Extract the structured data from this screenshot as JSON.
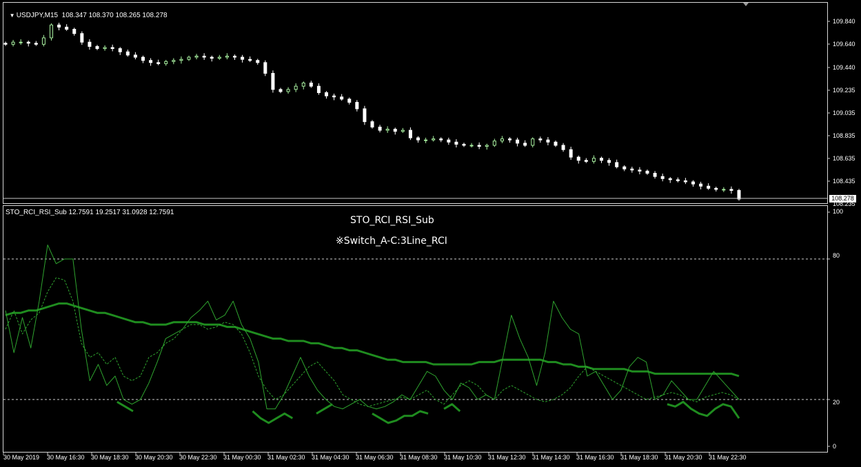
{
  "main_title": "USDJPY,M15  108.347 108.370 108.265 108.278",
  "price_axis": [
    "109.840",
    "109.640",
    "109.440",
    "109.235",
    "109.035",
    "108.835",
    "108.635",
    "108.435",
    "108.235"
  ],
  "current_price": "108.278",
  "indicator_title": "STO_RCI_RSI_Sub 12.7591 19.2517 31.0928 12.7591",
  "indicator_name": "STO_RCI_RSI_Sub",
  "indicator_mode": "※Switch_A-C:3Line_RCI",
  "ind_axis": [
    "100",
    "80",
    "20",
    "0"
  ],
  "time_axis": [
    "30 May 2019",
    "30 May 16:30",
    "30 May 18:30",
    "30 May 20:30",
    "30 May 22:30",
    "31 May 00:30",
    "31 May 02:30",
    "31 May 04:30",
    "31 May 06:30",
    "31 May 08:30",
    "31 May 10:30",
    "31 May 12:30",
    "31 May 14:30",
    "31 May 16:30",
    "31 May 18:30",
    "31 May 20:30",
    "31 May 22:30"
  ],
  "colors": {
    "bull": "#a8f0a0",
    "bear": "#ffffff",
    "line": "#1f8c1f",
    "thin": "#2fa52f"
  },
  "chart_data": [
    {
      "type": "candlestick",
      "symbol": "USDJPY",
      "timeframe": "M15",
      "ylim": [
        108.235,
        109.94
      ],
      "close_path": [
        109.72,
        109.74,
        109.74,
        109.73,
        109.72,
        109.78,
        109.9,
        109.88,
        109.86,
        109.82,
        109.74,
        109.7,
        109.68,
        109.69,
        109.68,
        109.65,
        109.62,
        109.6,
        109.57,
        109.55,
        109.54,
        109.56,
        109.57,
        109.58,
        109.6,
        109.61,
        109.6,
        109.59,
        109.6,
        109.61,
        109.6,
        109.58,
        109.57,
        109.55,
        109.45,
        109.3,
        109.28,
        109.3,
        109.33,
        109.36,
        109.33,
        109.27,
        109.24,
        109.23,
        109.21,
        109.18,
        109.12,
        109.0,
        108.95,
        108.92,
        108.93,
        108.91,
        108.92,
        108.85,
        108.83,
        108.83,
        108.84,
        108.83,
        108.81,
        108.79,
        108.78,
        108.78,
        108.77,
        108.78,
        108.82,
        108.84,
        108.83,
        108.8,
        108.78,
        108.84,
        108.83,
        108.81,
        108.78,
        108.74,
        108.67,
        108.64,
        108.63,
        108.66,
        108.64,
        108.62,
        108.58,
        108.56,
        108.55,
        108.54,
        108.52,
        108.49,
        108.47,
        108.46,
        108.45,
        108.44,
        108.42,
        108.4,
        108.38,
        108.37,
        108.37,
        108.36,
        108.28
      ]
    },
    {
      "type": "line",
      "title": "STO_RCI_RSI_Sub",
      "ylim": [
        0,
        100
      ],
      "levels": [
        80,
        20
      ],
      "series": [
        {
          "values": [
            56,
            57,
            57,
            58,
            58,
            59,
            60,
            61,
            61,
            60,
            59,
            58,
            57,
            57,
            56,
            55,
            54,
            53,
            53,
            52,
            52,
            52,
            53,
            53,
            53,
            53,
            52,
            52,
            52,
            51,
            51,
            50,
            49,
            48,
            47,
            46,
            46,
            45,
            45,
            45,
            44,
            44,
            43,
            42,
            42,
            41,
            41,
            40,
            39,
            38,
            37,
            37,
            36,
            36,
            36,
            36,
            35,
            35,
            35,
            35,
            35,
            35,
            36,
            36,
            36,
            37,
            37,
            37,
            37,
            37,
            37,
            36,
            36,
            35,
            35,
            34,
            34,
            33,
            33,
            33,
            33,
            33,
            32,
            32,
            32,
            31,
            31,
            31,
            31,
            31,
            31,
            31,
            31,
            31,
            31,
            31,
            30
          ]
        },
        {
          "values": [
            50,
            58,
            48,
            54,
            57,
            66,
            72,
            71,
            62,
            44,
            38,
            40,
            35,
            38,
            30,
            28,
            30,
            38,
            40,
            44,
            46,
            50,
            52,
            52,
            50,
            51,
            53,
            52,
            48,
            40,
            30,
            24,
            20,
            22,
            26,
            30,
            34,
            36,
            32,
            28,
            22,
            20,
            18,
            17,
            18,
            19,
            20,
            21,
            20,
            22,
            24,
            20,
            18,
            22,
            26,
            28,
            26,
            22,
            20,
            24,
            26,
            24,
            22,
            20,
            19,
            20,
            22,
            25,
            30,
            34,
            32,
            30,
            28,
            26,
            24,
            22,
            20,
            21,
            22,
            23,
            22,
            20,
            19,
            21,
            22,
            23,
            22,
            20
          ]
        },
        {
          "values": [
            58,
            40,
            55,
            42,
            62,
            86,
            78,
            80,
            80,
            50,
            28,
            35,
            26,
            30,
            20,
            18,
            20,
            27,
            36,
            46,
            48,
            50,
            55,
            58,
            62,
            54,
            56,
            62,
            52,
            46,
            36,
            16,
            16,
            22,
            30,
            38,
            30,
            24,
            20,
            17,
            16,
            18,
            20,
            17,
            16,
            17,
            19,
            22,
            20,
            26,
            32,
            30,
            24,
            20,
            27,
            25,
            20,
            22,
            20,
            38,
            56,
            46,
            38,
            26,
            40,
            62,
            55,
            50,
            48,
            30,
            32,
            26,
            20,
            24,
            34,
            38,
            36,
            20,
            22,
            28,
            24,
            20,
            20,
            26,
            32,
            28,
            24,
            20
          ]
        },
        {
          "values": [
            null,
            null,
            null,
            null,
            null,
            null,
            null,
            null,
            null,
            null,
            null,
            null,
            null,
            null,
            19,
            17,
            15,
            null,
            null,
            null,
            null,
            null,
            null,
            null,
            null,
            null,
            null,
            null,
            null,
            null,
            null,
            15,
            12,
            10,
            12,
            14,
            12,
            null,
            null,
            14,
            16,
            18,
            null,
            null,
            null,
            null,
            14,
            12,
            10,
            11,
            13,
            13,
            15,
            14,
            null,
            16,
            18,
            15,
            null,
            null,
            null,
            null,
            null,
            null,
            null,
            null,
            null,
            null,
            null,
            null,
            null,
            null,
            null,
            null,
            null,
            null,
            null,
            null,
            null,
            null,
            null,
            null,
            null,
            18,
            17,
            19,
            16,
            14,
            13,
            16,
            18,
            17,
            12
          ]
        }
      ]
    }
  ]
}
